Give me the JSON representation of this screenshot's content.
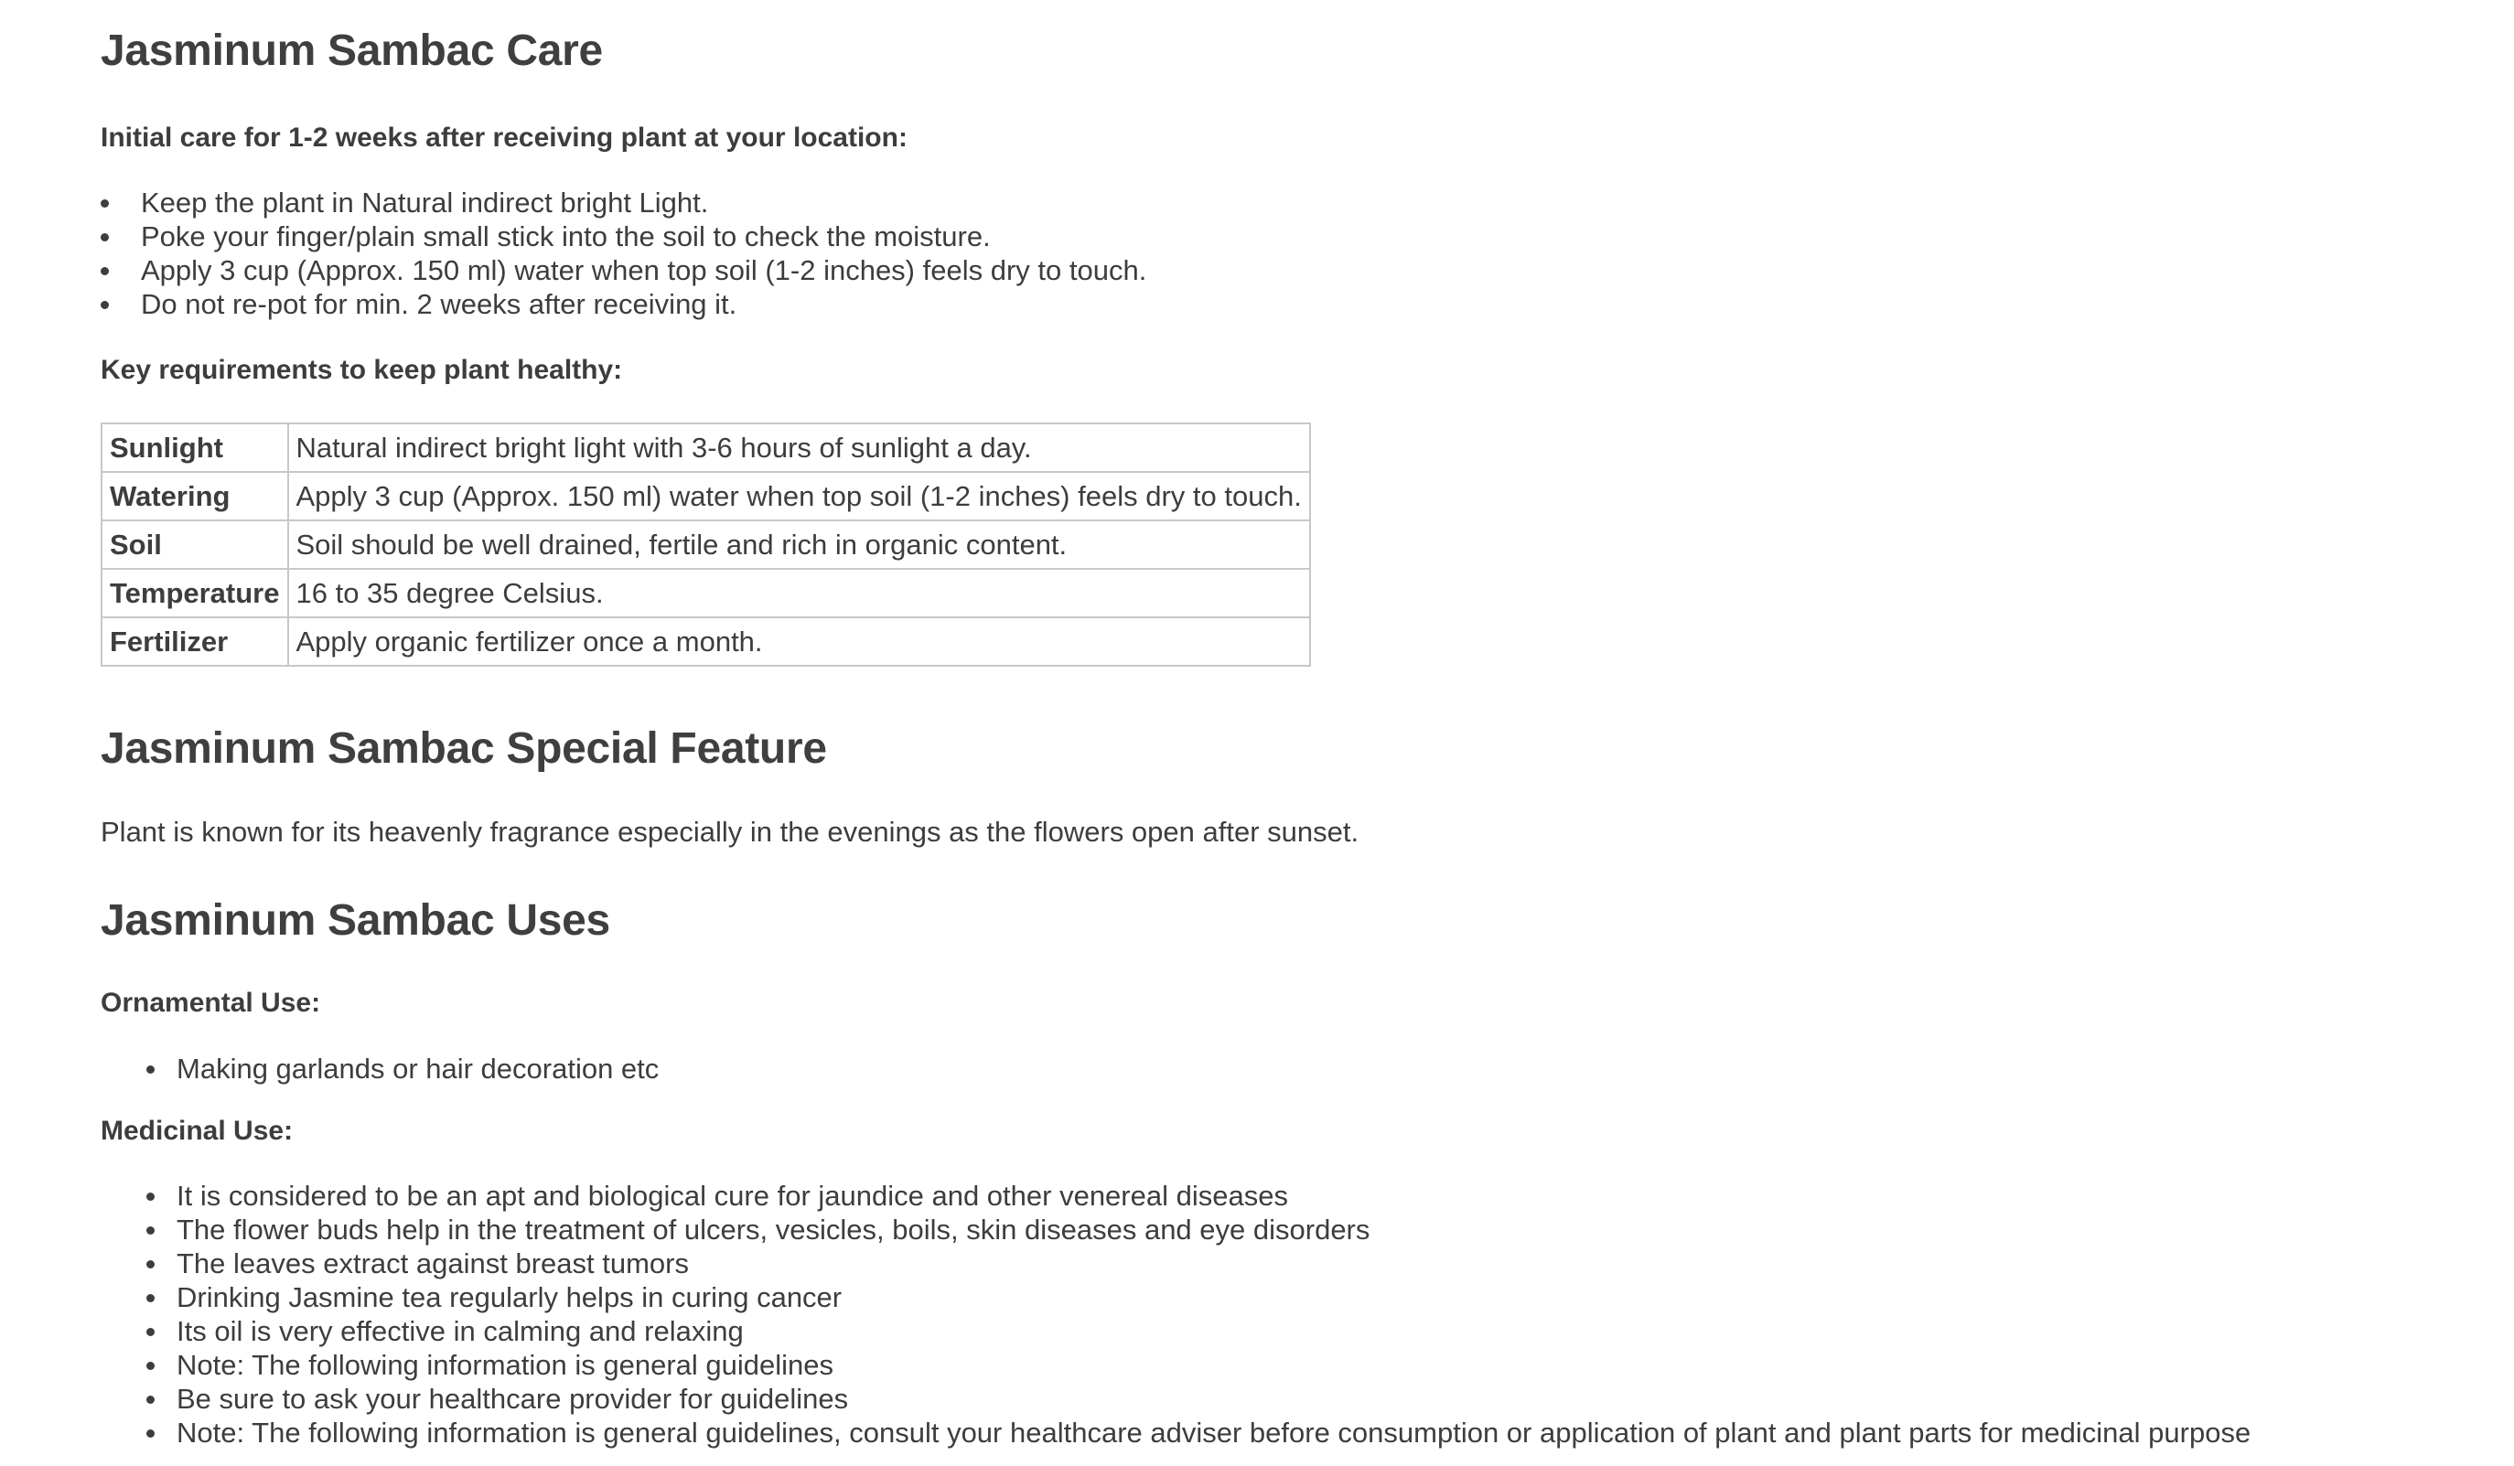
{
  "care": {
    "heading": "Jasminum Sambac Care",
    "initial_label": "Initial care for 1-2 weeks after receiving plant at your location:",
    "initial_items": [
      "Keep the plant in Natural indirect bright Light.",
      "Poke your finger/plain small stick into the soil to check the moisture.",
      "Apply 3 cup (Approx. 150 ml) water when top soil (1-2 inches) feels dry to touch.",
      "Do not re-pot for min. 2 weeks after receiving it."
    ],
    "requirements_label": "Key requirements to keep plant healthy:",
    "requirements": [
      {
        "key": "Sunlight",
        "value": "Natural indirect bright light with 3-6 hours of sunlight a day."
      },
      {
        "key": "Watering",
        "value": "Apply 3 cup (Approx. 150 ml) water when top soil (1-2 inches) feels dry to touch."
      },
      {
        "key": "Soil",
        "value": "Soil should be well drained, fertile and rich in organic content."
      },
      {
        "key": "Temperature",
        "value": "16 to 35 degree Celsius."
      },
      {
        "key": "Fertilizer",
        "value": "Apply organic fertilizer once a month."
      }
    ]
  },
  "feature": {
    "heading": "Jasminum Sambac Special Feature",
    "text": "Plant is known for its heavenly fragrance especially in the evenings as the flowers open after sunset."
  },
  "uses": {
    "heading": "Jasminum Sambac Uses",
    "ornamental_label": "Ornamental Use:",
    "ornamental_items": [
      "Making garlands or hair decoration etc"
    ],
    "medicinal_label": "Medicinal Use:",
    "medicinal_items": [
      "It is considered to be an apt and biological cure for jaundice and other venereal diseases",
      "The flower buds help in the treatment of ulcers, vesicles, boils, skin diseases and eye disorders",
      "The leaves extract against breast tumors",
      "Drinking Jasmine tea regularly helps in curing cancer",
      "Its oil is very effective in calming and relaxing",
      "Note: The following information is general guidelines",
      "Be sure to ask your healthcare provider for guidelines",
      "Note: The following information is general guidelines, consult your healthcare adviser before consumption or application of plant and plant parts for medicinal purpose"
    ]
  }
}
